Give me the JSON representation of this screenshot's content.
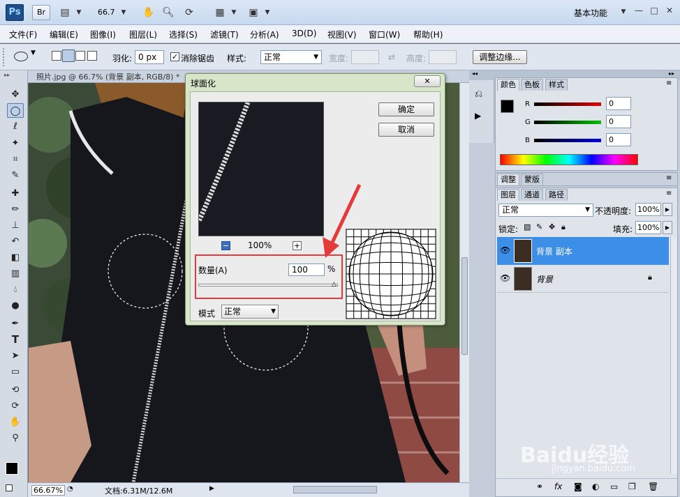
{
  "titlebar": {
    "app_logo": "Ps",
    "bridge_label": "Br",
    "zoom_value": "66.7",
    "workspace": "基本功能",
    "icons": [
      "film-strip-icon",
      "hand-icon",
      "zoom-icon",
      "rotate-view-icon",
      "arrange-docs-icon",
      "screen-mode-icon"
    ]
  },
  "menu": [
    "文件(F)",
    "编辑(E)",
    "图像(I)",
    "图层(L)",
    "选择(S)",
    "滤镜(T)",
    "分析(A)",
    "3D(D)",
    "视图(V)",
    "窗口(W)",
    "帮助(H)"
  ],
  "options": {
    "feather_label": "羽化:",
    "feather_value": "0 px",
    "antialias_label": "消除锯齿",
    "style_label": "样式:",
    "style_value": "正常",
    "width_label": "宽度:",
    "height_label": "高度:",
    "refine_edge": "调整边缘..."
  },
  "document": {
    "tab_title": "照片.jpg @ 66.7% (背景 副本, RGB/8) *",
    "zoom": "66.67%",
    "doc_info": "文档:6.31M/12.6M"
  },
  "dialog": {
    "title": "球面化",
    "ok": "确定",
    "cancel": "取消",
    "preview_zoom": "100%",
    "amount_label": "数量(A)",
    "amount_value": "100",
    "amount_unit": "%",
    "amount_fraction": 1.0,
    "mode_label": "模式",
    "mode_value": "正常"
  },
  "color_panel": {
    "tabs": [
      "颜色",
      "色板",
      "样式"
    ],
    "channels": [
      {
        "name": "R",
        "value": "0",
        "color": "#e00000"
      },
      {
        "name": "G",
        "value": "0",
        "color": "#00c000"
      },
      {
        "name": "B",
        "value": "0",
        "color": "#0000e0"
      }
    ]
  },
  "adjust_tabs": [
    "调整",
    "蒙版"
  ],
  "layers_panel": {
    "tabs": [
      "图层",
      "通道",
      "路径"
    ],
    "blend_mode": "正常",
    "opacity_label": "不透明度:",
    "opacity_value": "100%",
    "lock_label": "锁定:",
    "fill_label": "填充:",
    "fill_value": "100%",
    "layers": [
      {
        "name": "背景 副本",
        "selected": true,
        "locked": false
      },
      {
        "name": "背景",
        "selected": false,
        "locked": true
      }
    ]
  },
  "watermark": {
    "brand": "Baidu经验",
    "url": "jingyan.baidu.com"
  },
  "colors": {
    "selection_highlight": "#3d8ee6",
    "annotation_red": "#e53a3a"
  }
}
